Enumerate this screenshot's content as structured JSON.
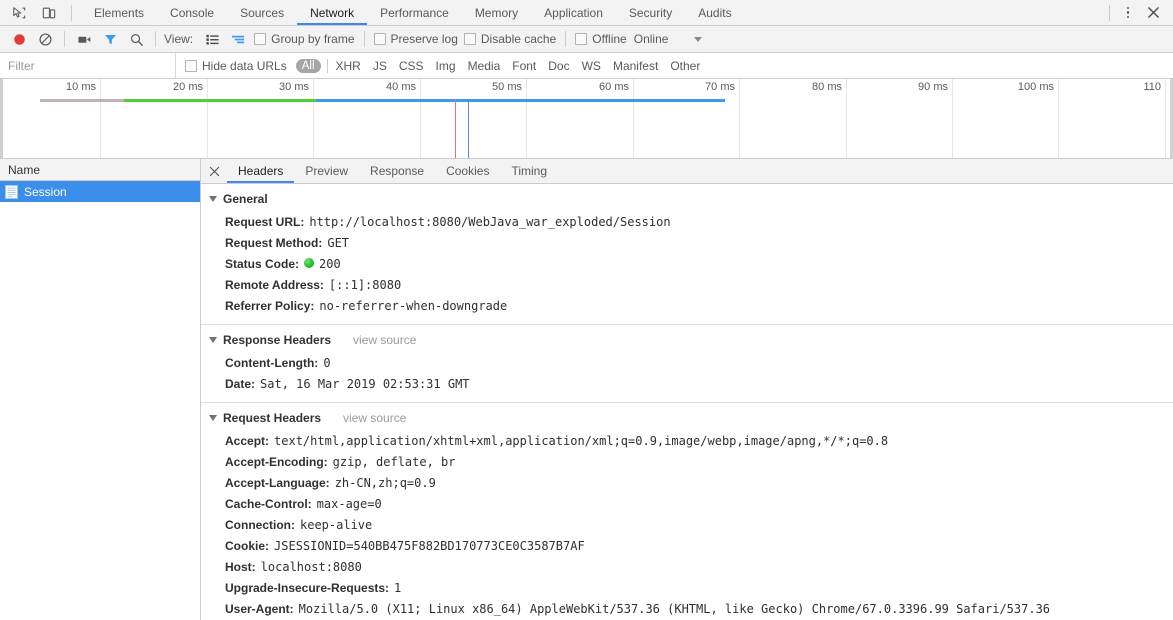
{
  "devtools_tabs": {
    "inspect_icon": "cursor-select-icon",
    "device_icon": "device-toolbar-icon",
    "items": [
      {
        "label": "Elements",
        "active": false
      },
      {
        "label": "Console",
        "active": false
      },
      {
        "label": "Sources",
        "active": false
      },
      {
        "label": "Network",
        "active": true
      },
      {
        "label": "Performance",
        "active": false
      },
      {
        "label": "Memory",
        "active": false
      },
      {
        "label": "Application",
        "active": false
      },
      {
        "label": "Security",
        "active": false
      },
      {
        "label": "Audits",
        "active": false
      }
    ],
    "more_icon": "kebab-menu-icon",
    "close_icon": "close-icon"
  },
  "network_toolbar": {
    "record_icon": "record-icon",
    "clear_icon": "clear-icon",
    "capture_screenshots_icon": "camera-icon",
    "filter_icon": "filter-icon",
    "search_icon": "search-icon",
    "view_label": "View:",
    "view_list_icon": "list-view-icon",
    "view_waterfall_icon": "waterfall-view-icon",
    "group_by_frame": "Group by frame",
    "preserve_log": "Preserve log",
    "disable_cache": "Disable cache",
    "offline": "Offline",
    "throttling_value": "Online"
  },
  "filter_bar": {
    "placeholder": "Filter",
    "value": "",
    "hide_data_urls": "Hide data URLs",
    "types": [
      {
        "label": "All",
        "selected": true
      },
      {
        "label": "XHR",
        "selected": false
      },
      {
        "label": "JS",
        "selected": false
      },
      {
        "label": "CSS",
        "selected": false
      },
      {
        "label": "Img",
        "selected": false
      },
      {
        "label": "Media",
        "selected": false
      },
      {
        "label": "Font",
        "selected": false
      },
      {
        "label": "Doc",
        "selected": false
      },
      {
        "label": "WS",
        "selected": false
      },
      {
        "label": "Manifest",
        "selected": false
      },
      {
        "label": "Other",
        "selected": false
      }
    ]
  },
  "overview": {
    "ticks": [
      "10 ms",
      "20 ms",
      "30 ms",
      "40 ms",
      "50 ms",
      "60 ms",
      "70 ms",
      "80 ms",
      "90 ms",
      "100 ms",
      "110"
    ],
    "bars": [
      {
        "name": "queueing",
        "color": "#bfb4b4",
        "left_pct": 3.4,
        "width_pct": 7.2
      },
      {
        "name": "waiting",
        "color": "#4cd137",
        "left_pct": 10.6,
        "width_pct": 16.3
      },
      {
        "name": "downloading",
        "color": "#3b9bf0",
        "left_pct": 26.9,
        "width_pct": 34.9
      }
    ],
    "events": [
      {
        "name": "dom-content-loaded",
        "color": "#e8707a",
        "left_pct": 38.8
      },
      {
        "name": "load",
        "color": "#6c7bf0",
        "left_pct": 39.9
      }
    ]
  },
  "request_list": {
    "column_header": "Name",
    "rows": [
      {
        "name": "Session",
        "icon": "document-icon",
        "selected": true
      }
    ]
  },
  "detail": {
    "close_icon": "close-icon",
    "tabs": [
      {
        "label": "Headers",
        "active": true
      },
      {
        "label": "Preview",
        "active": false
      },
      {
        "label": "Response",
        "active": false
      },
      {
        "label": "Cookies",
        "active": false
      },
      {
        "label": "Timing",
        "active": false
      }
    ],
    "sections": [
      {
        "title": "General",
        "view_source": "",
        "rows": [
          {
            "name": "Request URL:",
            "value": "http://localhost:8080/WebJava_war_exploded/Session"
          },
          {
            "name": "Request Method:",
            "value": "GET"
          },
          {
            "name": "Status Code:",
            "value": "200",
            "status_dot": true
          },
          {
            "name": "Remote Address:",
            "value": "[::1]:8080"
          },
          {
            "name": "Referrer Policy:",
            "value": "no-referrer-when-downgrade"
          }
        ]
      },
      {
        "title": "Response Headers",
        "view_source": "view source",
        "rows": [
          {
            "name": "Content-Length:",
            "value": "0"
          },
          {
            "name": "Date:",
            "value": "Sat, 16 Mar 2019 02:53:31 GMT"
          }
        ]
      },
      {
        "title": "Request Headers",
        "view_source": "view source",
        "rows": [
          {
            "name": "Accept:",
            "value": "text/html,application/xhtml+xml,application/xml;q=0.9,image/webp,image/apng,*/*;q=0.8"
          },
          {
            "name": "Accept-Encoding:",
            "value": "gzip, deflate, br"
          },
          {
            "name": "Accept-Language:",
            "value": "zh-CN,zh;q=0.9"
          },
          {
            "name": "Cache-Control:",
            "value": "max-age=0"
          },
          {
            "name": "Connection:",
            "value": "keep-alive"
          },
          {
            "name": "Cookie:",
            "value": "JSESSIONID=540BB475F882BD170773CE0C3587B7AF"
          },
          {
            "name": "Host:",
            "value": "localhost:8080"
          },
          {
            "name": "Upgrade-Insecure-Requests:",
            "value": "1"
          },
          {
            "name": "User-Agent:",
            "value": "Mozilla/5.0 (X11; Linux x86_64) AppleWebKit/537.36 (KHTML, like Gecko) Chrome/67.0.3396.99 Safari/537.36"
          }
        ]
      }
    ]
  },
  "colors": {
    "accent": "#4285f4",
    "selection": "#3b8eea",
    "record": "#e03a3a",
    "filter_active": "#3b9bf0"
  }
}
